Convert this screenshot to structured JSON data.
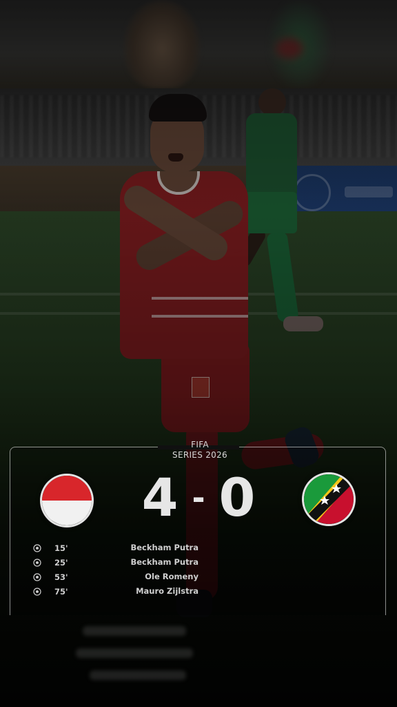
{
  "match": {
    "event_line1": "FIFA",
    "event_line2": "SERIES 2026",
    "home_score": "4",
    "separator": "-",
    "away_score": "0",
    "home_flag": "indonesia-flag-icon",
    "away_flag": "saint-kitts-and-nevis-flag-icon"
  },
  "goals": [
    {
      "icon": "football-icon",
      "minute": "15'",
      "scorer": "Beckham Putra"
    },
    {
      "icon": "football-icon",
      "minute": "25'",
      "scorer": "Beckham Putra"
    },
    {
      "icon": "football-icon",
      "minute": "53'",
      "scorer": "Ole Romeny"
    },
    {
      "icon": "football-icon",
      "minute": "75'",
      "scorer": "Mauro Zijlstra"
    }
  ],
  "colors": {
    "home_red": "#d8262b",
    "home_white": "#f1f1f1",
    "away_green": "#1a9a3b",
    "away_red": "#c8102e",
    "away_black": "#111111",
    "away_yellow": "#f5c518",
    "player_kit": "#8c1f22"
  }
}
